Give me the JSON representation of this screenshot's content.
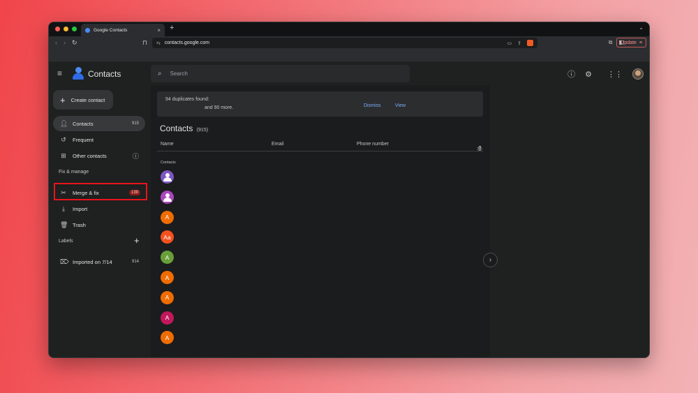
{
  "browser": {
    "tab_title": "Google Contacts",
    "tab_close": "×",
    "new_tab": "+",
    "url": "contacts.google.com",
    "update_label": "Update"
  },
  "header": {
    "title": "Contacts",
    "search_placeholder": "Search"
  },
  "sidebar": {
    "create_label": "Create contact",
    "items": [
      {
        "label": "Contacts",
        "count": "915"
      },
      {
        "label": "Frequent",
        "count": ""
      },
      {
        "label": "Other contacts",
        "count": ""
      }
    ],
    "fix_section": "Fix & manage",
    "fix_items": [
      {
        "label": "Merge & fix",
        "badge": "139"
      },
      {
        "label": "Import"
      },
      {
        "label": "Trash"
      }
    ],
    "labels_section": "Labels",
    "labels": [
      {
        "label": "Imported on 7/14",
        "count": "914"
      }
    ]
  },
  "main": {
    "banner_line1": "94 duplicates found:",
    "banner_line2": "and 90 more.",
    "dismiss_label": "Dismiss",
    "view_label": "View",
    "title": "Contacts",
    "count": "(915)",
    "columns": [
      "Name",
      "Email",
      "Phone number"
    ],
    "group_label": "Contacts",
    "rows": [
      {
        "initial": "",
        "color": "#7e57c2",
        "photo": true
      },
      {
        "initial": "",
        "color": "#ab47bc",
        "photo": true
      },
      {
        "initial": "A",
        "color": "#ef6c00",
        "photo": false
      },
      {
        "initial": "Aa",
        "color": "#f4511e",
        "photo": false
      },
      {
        "initial": "A",
        "color": "#689f38",
        "photo": false
      },
      {
        "initial": "A",
        "color": "#ef6c00",
        "photo": false
      },
      {
        "initial": "A",
        "color": "#ef6c00",
        "photo": false
      },
      {
        "initial": "A",
        "color": "#c2185b",
        "photo": false
      },
      {
        "initial": "A",
        "color": "#ef6c00",
        "photo": false
      }
    ]
  }
}
